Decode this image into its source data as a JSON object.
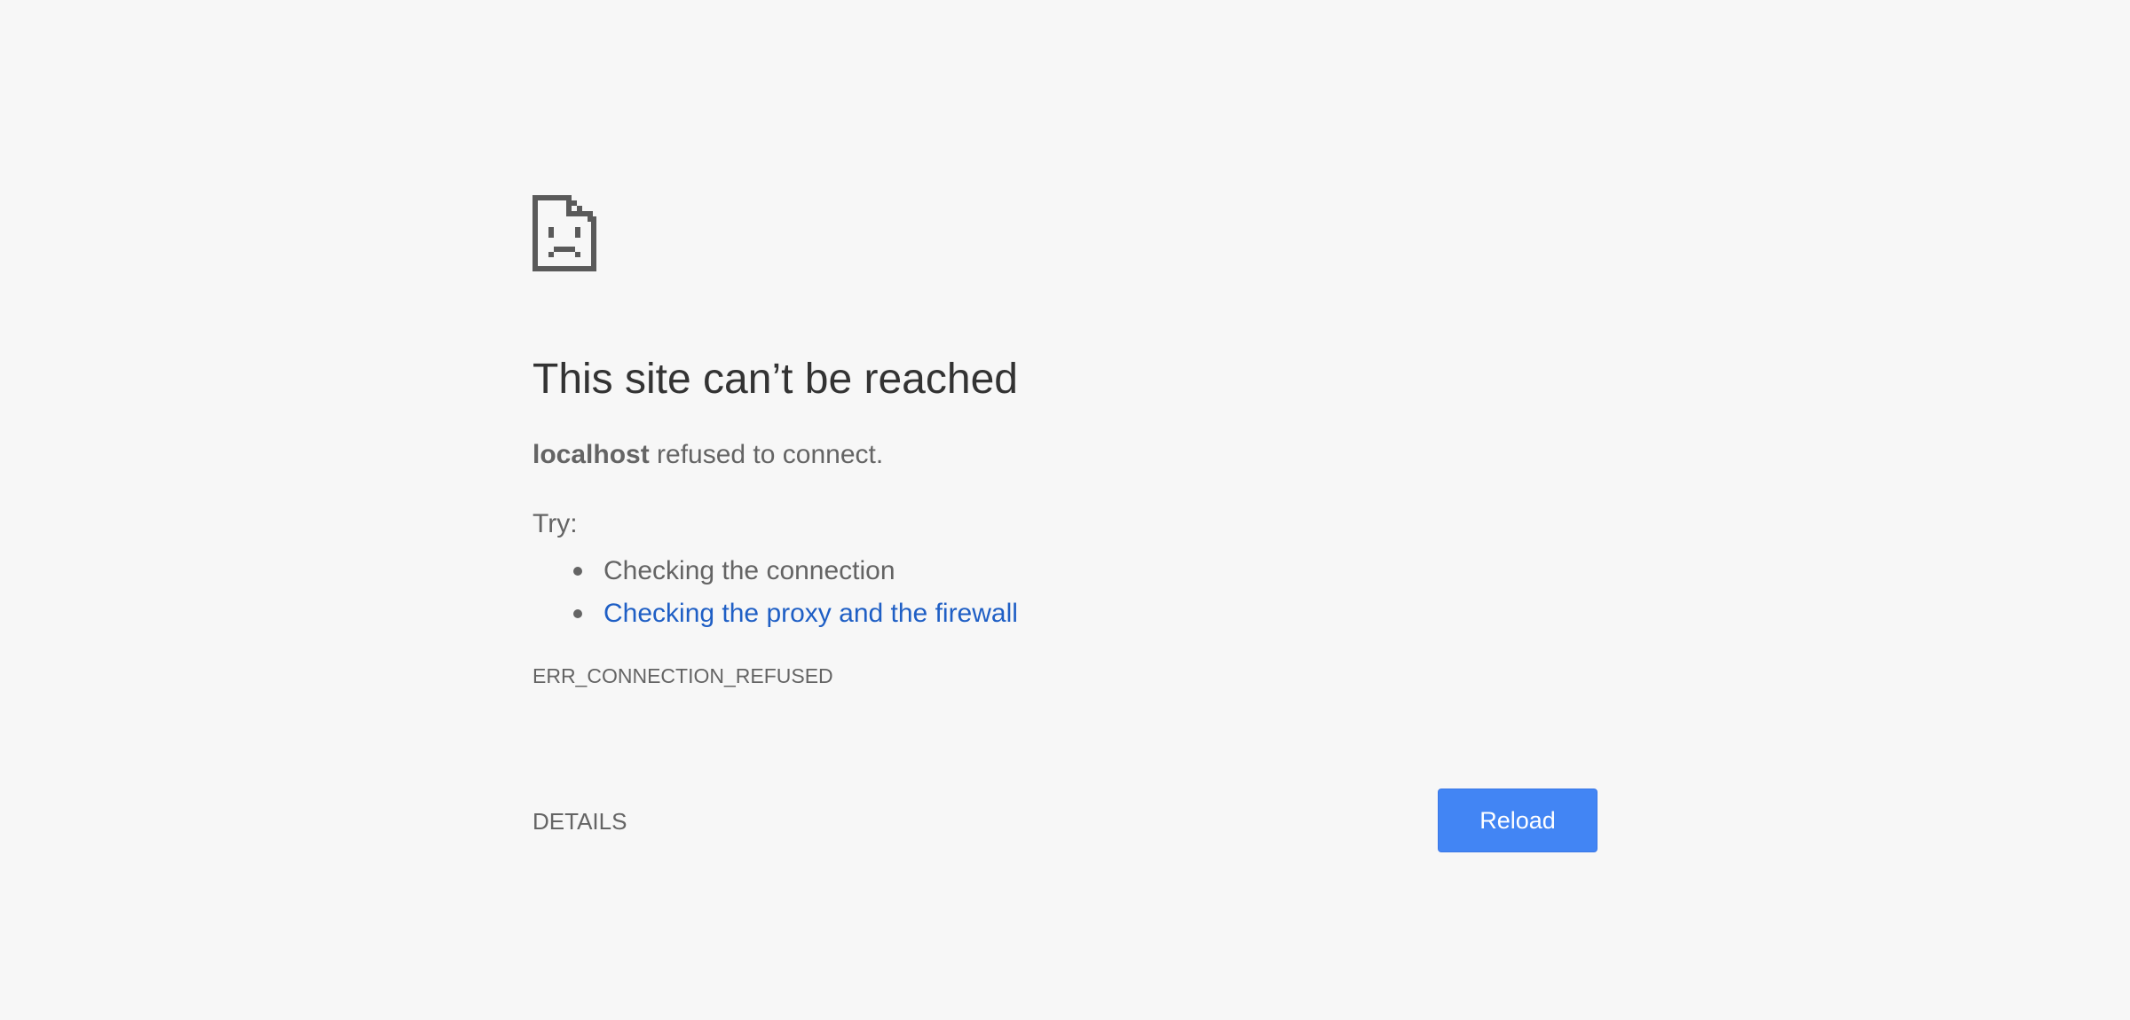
{
  "error": {
    "title": "This site can’t be reached",
    "host": "localhost",
    "message": " refused to connect.",
    "try_label": "Try:",
    "suggestions": [
      {
        "text": "Checking the connection",
        "is_link": false
      },
      {
        "text": "Checking the proxy and the firewall",
        "is_link": true
      }
    ],
    "code": "ERR_CONNECTION_REFUSED"
  },
  "actions": {
    "details_label": "DETAILS",
    "reload_label": "Reload"
  },
  "icons": {
    "main": "sad-page-icon"
  },
  "colors": {
    "background": "#f7f7f7",
    "title": "#333333",
    "text": "#646464",
    "link": "#1f5fc5",
    "button": "#4285f4"
  }
}
